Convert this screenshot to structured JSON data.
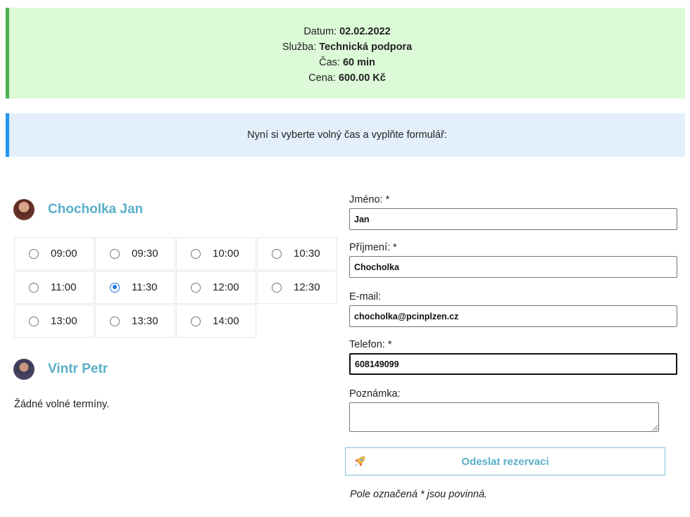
{
  "summary": {
    "date_label": "Datum: ",
    "date_value": "02.02.2022",
    "service_label": "Služba: ",
    "service_value": "Technická podpora",
    "time_label": "Čas: ",
    "time_value": "60 min",
    "price_label": "Cena: ",
    "price_value": "600.00 Kč"
  },
  "notice": "Nyní si vyberte volný čas a vyplňte formulář:",
  "workers": [
    {
      "name": "Chocholka Jan",
      "slots": [
        {
          "time": "09:00",
          "checked": false
        },
        {
          "time": "09:30",
          "checked": false
        },
        {
          "time": "10:00",
          "checked": false
        },
        {
          "time": "10:30",
          "checked": false
        },
        {
          "time": "11:00",
          "checked": false
        },
        {
          "time": "11:30",
          "checked": true
        },
        {
          "time": "12:00",
          "checked": false
        },
        {
          "time": "12:30",
          "checked": false
        },
        {
          "time": "13:00",
          "checked": false
        },
        {
          "time": "13:30",
          "checked": false
        },
        {
          "time": "14:00",
          "checked": false
        }
      ]
    },
    {
      "name": "Vintr Petr",
      "no_slots_text": "Žádné volné termíny."
    }
  ],
  "form": {
    "first_name_label": "Jméno: *",
    "first_name_value": "Jan",
    "last_name_label": "Příjmení: *",
    "last_name_value": "Chocholka",
    "email_label": "E-mail:",
    "email_value": "chocholka@pcinplzen.cz",
    "phone_label": "Telefon: *",
    "phone_value": "608149099",
    "note_label": "Poznámka:",
    "note_value": "",
    "submit_label": "Odeslat rezervaci",
    "required_note": "Pole označená * jsou povinná."
  },
  "icons": {
    "submit_icon": "rocket-icon"
  },
  "colors": {
    "summary_bg": "#dcf9d8",
    "summary_border": "#4caf50",
    "notice_bg": "#e3f0fc",
    "notice_border": "#2196f3",
    "accent": "#5ab0c9",
    "radio_checked": "#1a73e8"
  }
}
